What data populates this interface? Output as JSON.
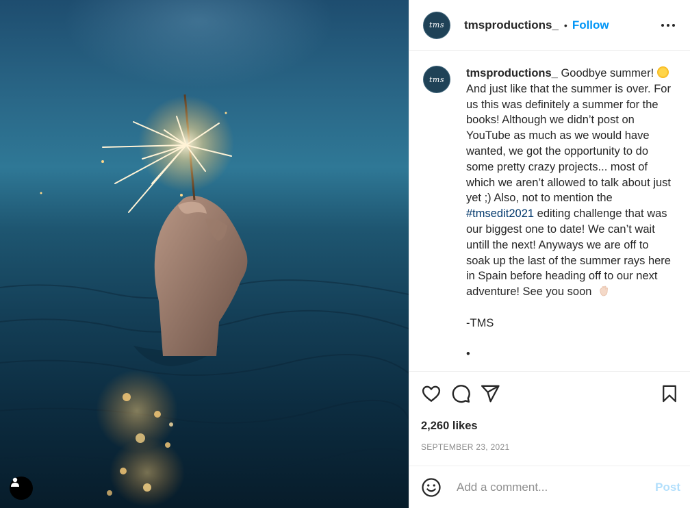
{
  "post": {
    "author": {
      "avatar_text": "tms",
      "username": "tmsproductions_",
      "follow_label": "Follow"
    },
    "caption": {
      "username": "tmsproductions_",
      "text_1": " Goodbye summer! ",
      "text_2": "And just like that the summer is over. For us this was definitely a summer for the books! Although we didn’t post on YouTube as much as we would have wanted, we got the opportunity to do some pretty crazy projects... most of which we aren’t allowed to talk about just yet ;) Also, not to mention the ",
      "hashtag": "#tmsedit2021",
      "text_3": " editing challenge that was our biggest one to date! We can’t wait untill the next! Anyways we are off to soak up the last of the summer rays here in Spain before heading off to our next adventure! See you soon ",
      "signature": "-TMS",
      "bullet": "•"
    },
    "likes": "2,260 likes",
    "date": "September 23, 2021",
    "comment": {
      "placeholder": "Add a comment...",
      "post_label": "Post"
    },
    "icons": [
      "heart-icon",
      "comment-icon",
      "share-icon",
      "bookmark-icon",
      "emoji-icon",
      "more-icon",
      "user-tag-icon"
    ],
    "colors": {
      "accent": "#0095f6",
      "hashtag": "#00376b",
      "post_disabled": "#b2dffc",
      "muted": "#8e8e8e"
    }
  }
}
